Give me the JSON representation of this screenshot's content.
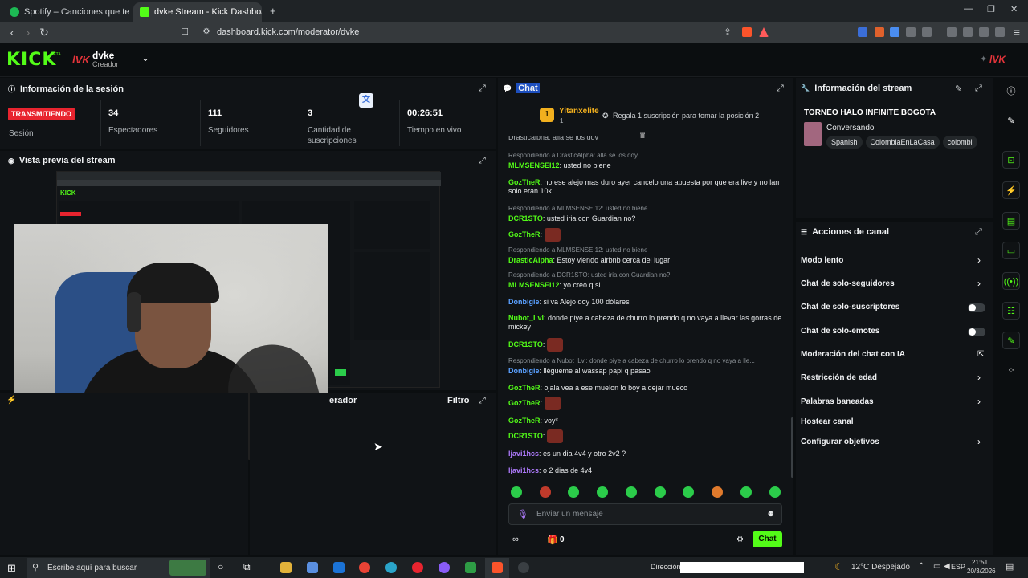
{
  "browser": {
    "tabs": [
      {
        "label": "Spotify – Canciones que te gustan"
      },
      {
        "label": "dvke Stream - Kick Dashboar"
      }
    ],
    "url": "dashboard.kick.com/moderator/dvke"
  },
  "header": {
    "logo": "KICK",
    "beta": "BETA",
    "channel_logo": "lVK",
    "channel_name": "dvke",
    "channel_role": "Creador",
    "right_logo": "lVK"
  },
  "session": {
    "title": "Información de la sesión",
    "live_badge": "TRANSMITIENDO",
    "session_label": "Sesión",
    "viewers_value": "34",
    "viewers_label": "Espectadores",
    "followers_value": "111",
    "followers_label": "Seguidores",
    "subs_value": "3",
    "subs_label": "Cantidad de suscripciones",
    "time_value": "00:26:51",
    "time_label": "Tiempo en vivo"
  },
  "preview": {
    "title": "Vista previa del stream"
  },
  "modlog": {
    "title": "erador",
    "filter": "Filtro"
  },
  "chat": {
    "title": "Chat",
    "pinned_user": "Yitanxelite",
    "pinned_rank": "1",
    "pinned_count": "1",
    "gift_text": "Regala 1 suscripción para tomar la posición 2",
    "top_cut": "Drasticaipha: alla se los doy",
    "messages": [
      {
        "reply": "Respondiendo a DrasticAlpha: alla se los doy",
        "user": "MLMSENSEI12",
        "color": "#53fc18",
        "text": "usted no biene",
        "top": "201"
      },
      {
        "user": "GozTheR",
        "color": "#53fc18",
        "text": "no ese alejo mas duro ayer cancelo una apuesta por que era live y no lan solo eran 10k",
        "top": "222"
      },
      {
        "reply": "Respondiendo a MLMSENSEI12: usted no biene",
        "user": "DCR1STO",
        "color": "#53fc18",
        "text": "usted iria con Guardian no?",
        "top": "267"
      },
      {
        "user": "GozTheR",
        "color": "#53fc18",
        "text": "",
        "emote": true,
        "top": "288"
      },
      {
        "reply": "Respondiendo a MLMSENSEI12: usted no biene",
        "user": "DrasticAlpha",
        "color": "#53fc18",
        "text": "Estoy viendo airbnb cerca del lugar",
        "top": "319"
      },
      {
        "reply": "Respondiendo a DCR1STO: usted iria con Guardian no?",
        "user": "MLMSENSEI12",
        "color": "#53fc18",
        "text": "yo creo q si",
        "top": "350"
      },
      {
        "user": "Donbigie",
        "color": "#5aa0ff",
        "text": "si va Alejo doy 100 dólares",
        "top": "371"
      },
      {
        "user": "Nubot_Lvl",
        "color": "#53fc18",
        "text": "donde piye a cabeza de churro lo prendo q no vaya a llevar las gorras de mickey",
        "top": "391"
      },
      {
        "user": "DCR1STO",
        "color": "#53fc18",
        "text": "",
        "emote": true,
        "top": "425"
      },
      {
        "reply": "Respondiendo a Nubot_Lvl: donde piye a cabeza de churro lo prendo q no vaya a lle...",
        "user": "Donbigie",
        "color": "#5aa0ff",
        "text": "llégueme al wassap papi q pasao",
        "top": "457"
      },
      {
        "user": "GozTheR",
        "color": "#53fc18",
        "text": "ojala vea a ese muelon lo boy a dejar mueco",
        "top": "478"
      },
      {
        "user": "GozTheR",
        "color": "#53fc18",
        "text": "",
        "emote": true,
        "top": "498"
      },
      {
        "user": "GozTheR",
        "color": "#53fc18",
        "text": "voy*",
        "top": "519"
      },
      {
        "user": "DCR1STO",
        "color": "#53fc18",
        "text": "",
        "emote": true,
        "top": "539"
      },
      {
        "user": "ljavi1hcs",
        "color": "#b07cff",
        "text": "es un dia 4v4 y otro 2v2 ?",
        "top": "560"
      },
      {
        "user": "ljavi1hcs",
        "color": "#b07cff",
        "text": "o 2 dias de 4v4",
        "top": "581"
      }
    ],
    "input_placeholder": "Enviar un mensaje",
    "points": "0",
    "send_label": "Chat"
  },
  "stream_info": {
    "title": "Información del stream",
    "stream_title": "TORNEO HALO INFINITE BOGOTA",
    "category": "Conversando",
    "tags": [
      "Spanish",
      "ColombiaEnLaCasa",
      "colombi"
    ]
  },
  "channel_actions": {
    "title": "Acciones de canal",
    "items": [
      {
        "label": "Modo lento",
        "control": "chevron"
      },
      {
        "label": "Chat de solo-seguidores",
        "control": "chevron"
      },
      {
        "label": "Chat de solo-suscriptores",
        "control": "toggle"
      },
      {
        "label": "Chat de solo-emotes",
        "control": "toggle"
      },
      {
        "label": "Moderación del chat con IA",
        "control": "external"
      },
      {
        "label": "Restricción de edad",
        "control": "chevron"
      },
      {
        "label": "Palabras baneadas",
        "control": "chevron"
      },
      {
        "label": "Hostear canal",
        "control": "none"
      },
      {
        "label": "Configurar objetivos",
        "control": "chevron"
      }
    ]
  },
  "taskbar": {
    "search_placeholder": "Escribe aquí para buscar",
    "address_label": "Dirección",
    "weather": "12°C  Despejado",
    "lang": "ESP",
    "time": "21:51",
    "date": "20/3/2026"
  },
  "colors": {
    "accent": "#53fc18",
    "live": "#e8242f",
    "panel": "#101316",
    "background": "#0b0e10"
  }
}
